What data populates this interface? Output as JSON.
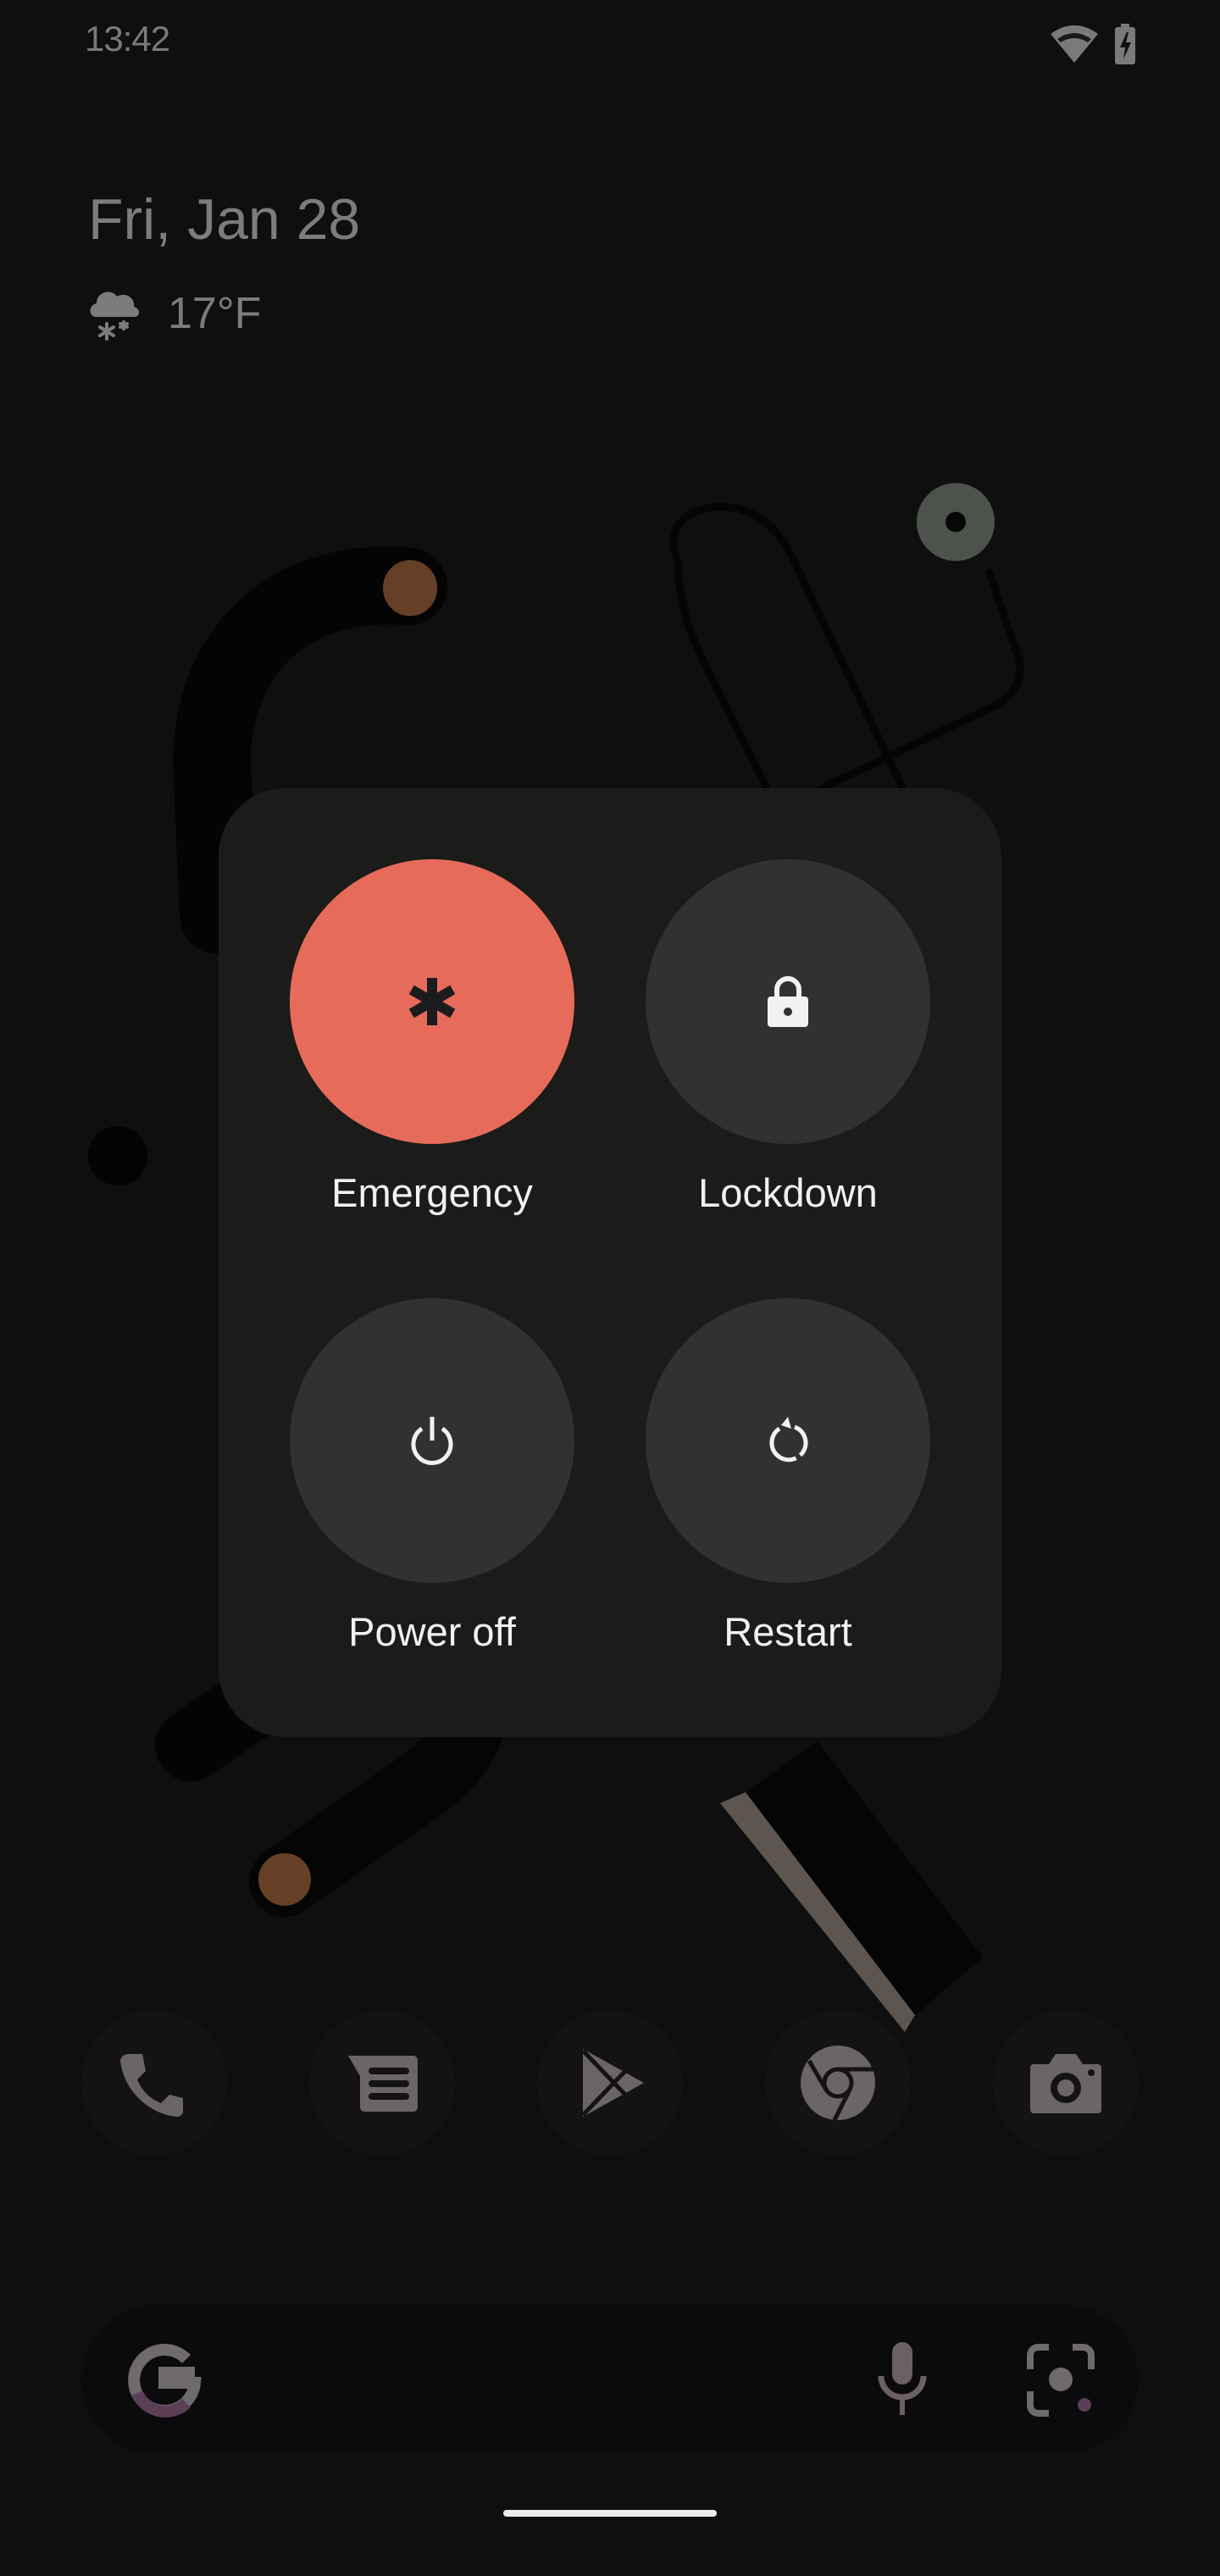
{
  "status_bar": {
    "time": "13:42",
    "icons": [
      "wifi-icon",
      "battery-charging-icon"
    ]
  },
  "at_a_glance": {
    "date": "Fri, Jan 28",
    "weather_icon": "snow-cloud-icon",
    "temperature": "17°F"
  },
  "power_menu": {
    "actions": [
      {
        "id": "emergency",
        "label": "Emergency",
        "icon": "emergency-asterisk-icon",
        "color": "#e76b5a"
      },
      {
        "id": "lockdown",
        "label": "Lockdown",
        "icon": "lock-icon",
        "color": "#313131"
      },
      {
        "id": "power_off",
        "label": "Power off",
        "icon": "power-icon",
        "color": "#313131"
      },
      {
        "id": "restart",
        "label": "Restart",
        "icon": "restart-icon",
        "color": "#313131"
      }
    ]
  },
  "dock": {
    "apps": [
      {
        "name": "Phone",
        "icon": "phone-icon"
      },
      {
        "name": "Messages",
        "icon": "messages-icon"
      },
      {
        "name": "Play Store",
        "icon": "play-store-icon"
      },
      {
        "name": "Chrome",
        "icon": "chrome-icon"
      },
      {
        "name": "Camera",
        "icon": "camera-icon"
      }
    ]
  },
  "search_bar": {
    "logo": "google-g-icon",
    "voice": "microphone-icon",
    "lens": "lens-icon"
  },
  "colors": {
    "background": "#0f0f0f",
    "dialog": "#1b1c19",
    "emergency": "#e76b5a",
    "button": "#313131",
    "label": "#f1f1f1",
    "dim_icon": "#6b6468"
  }
}
